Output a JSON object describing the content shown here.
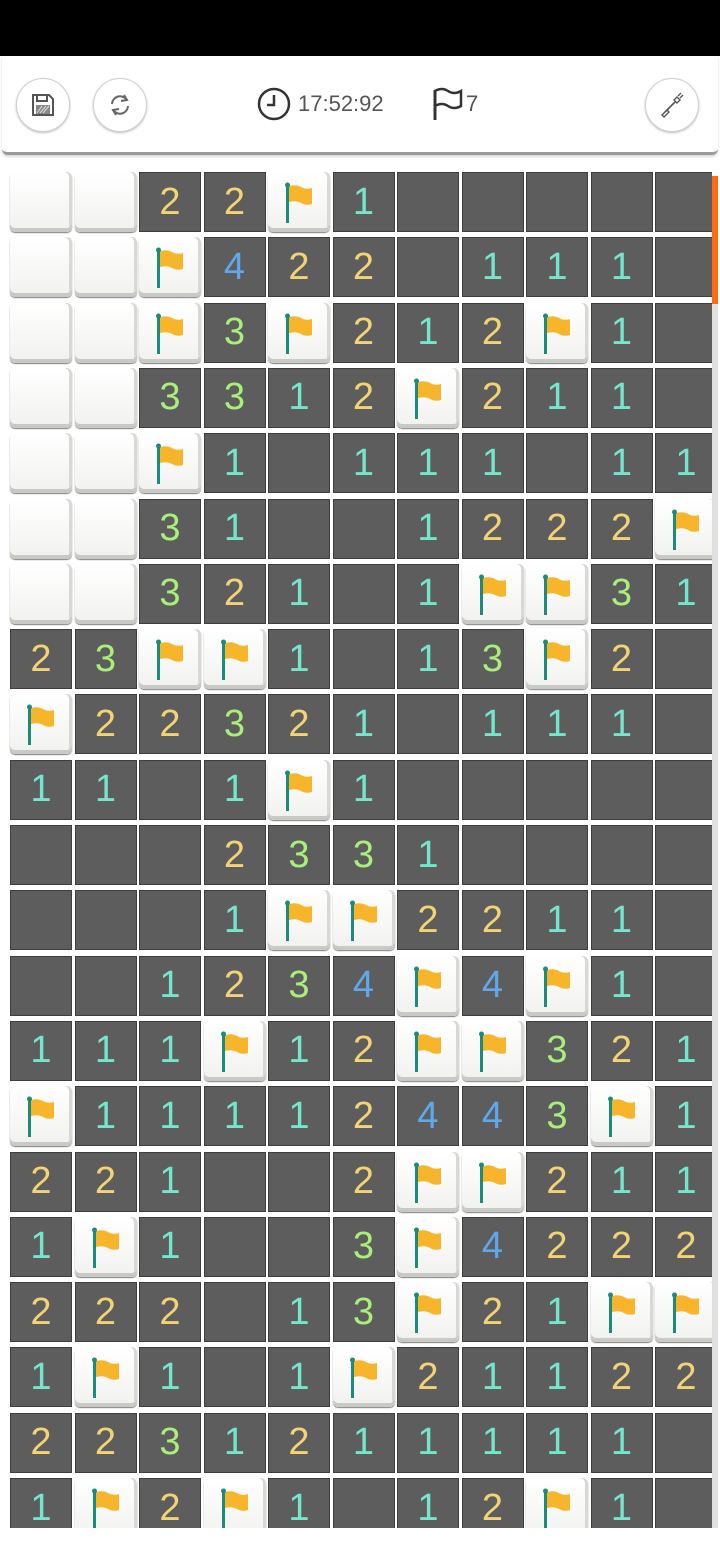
{
  "toolbar": {
    "timer": "17:52:92",
    "flags_remaining": "7",
    "save_icon": "save-icon",
    "restart_icon": "restart-icon",
    "clock_icon": "clock-icon",
    "flag_icon": "flag-outline-icon",
    "shovel_icon": "shovel-icon"
  },
  "colors": {
    "1": "#73e6cd",
    "2": "#f3d374",
    "3": "#a8f07a",
    "4": "#5ea8ec",
    "accent": "#ff6a13",
    "flag": "#f7b52c",
    "pole": "#1b8c7a"
  },
  "board": {
    "rows": [
      [
        "U",
        "U",
        "2",
        "2",
        "F",
        "1",
        "E",
        "E",
        "E",
        "E",
        "E"
      ],
      [
        "U",
        "U",
        "F",
        "4",
        "2",
        "2",
        "E",
        "1",
        "1",
        "1",
        "E"
      ],
      [
        "U",
        "U",
        "F",
        "3",
        "F",
        "2",
        "1",
        "2",
        "F",
        "1",
        "E"
      ],
      [
        "U",
        "U",
        "3",
        "3",
        "1",
        "2",
        "F",
        "2",
        "1",
        "1",
        "E"
      ],
      [
        "U",
        "U",
        "F",
        "1",
        "E",
        "1",
        "1",
        "1",
        "E",
        "1",
        "1"
      ],
      [
        "U",
        "U",
        "3",
        "1",
        "E",
        "E",
        "1",
        "2",
        "2",
        "2",
        "F"
      ],
      [
        "U",
        "U",
        "3",
        "2",
        "1",
        "E",
        "1",
        "F",
        "F",
        "3",
        "1"
      ],
      [
        "2",
        "3",
        "F",
        "F",
        "1",
        "E",
        "1",
        "3",
        "F",
        "2",
        "E"
      ],
      [
        "F",
        "2",
        "2",
        "3",
        "2",
        "1",
        "E",
        "1",
        "1",
        "1",
        "E"
      ],
      [
        "1",
        "1",
        "E",
        "1",
        "F",
        "1",
        "E",
        "E",
        "E",
        "E",
        "E"
      ],
      [
        "E",
        "E",
        "E",
        "2",
        "3",
        "3",
        "1",
        "E",
        "E",
        "E",
        "E"
      ],
      [
        "E",
        "E",
        "E",
        "1",
        "F",
        "F",
        "2",
        "2",
        "1",
        "1",
        "E"
      ],
      [
        "E",
        "E",
        "1",
        "2",
        "3",
        "4",
        "F",
        "4",
        "F",
        "1",
        "E"
      ],
      [
        "1",
        "1",
        "1",
        "F",
        "1",
        "2",
        "F",
        "F",
        "3",
        "2",
        "1"
      ],
      [
        "F",
        "1",
        "1",
        "1",
        "1",
        "2",
        "4",
        "4",
        "3",
        "F",
        "1"
      ],
      [
        "2",
        "2",
        "1",
        "E",
        "E",
        "2",
        "F",
        "F",
        "2",
        "1",
        "1"
      ],
      [
        "1",
        "F",
        "1",
        "E",
        "E",
        "3",
        "F",
        "4",
        "2",
        "2",
        "2"
      ],
      [
        "2",
        "2",
        "2",
        "E",
        "1",
        "3",
        "F",
        "2",
        "1",
        "F",
        "F"
      ],
      [
        "1",
        "F",
        "1",
        "E",
        "1",
        "F",
        "2",
        "1",
        "1",
        "2",
        "2"
      ],
      [
        "2",
        "2",
        "3",
        "1",
        "2",
        "1",
        "1",
        "1",
        "1",
        "1",
        "E"
      ],
      [
        "1",
        "F",
        "2",
        "F",
        "1",
        "E",
        "1",
        "2",
        "F",
        "1",
        "E"
      ]
    ]
  }
}
